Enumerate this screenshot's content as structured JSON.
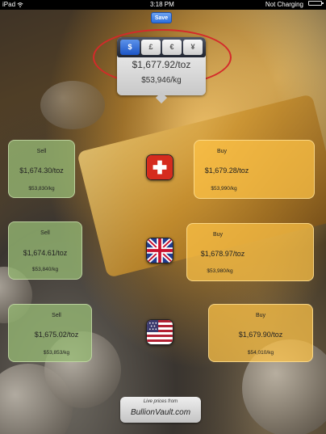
{
  "status_bar": {
    "device": "iPad",
    "time": "3:18 PM",
    "charging": "Not Charging"
  },
  "toolbar": {
    "save_label": "Save"
  },
  "currency_selector": {
    "options": [
      "$",
      "£",
      "€",
      "¥"
    ],
    "selected": "$",
    "price_per_toz": "$1,677.92/toz",
    "price_per_kg": "$53,946/kg"
  },
  "markets": [
    {
      "flag_icon": "switzerland-flag-icon",
      "sell": {
        "label": "Sell",
        "price_per_toz": "$1,674.30/toz",
        "price_per_kg": "$53,830/kg"
      },
      "buy": {
        "label": "Buy",
        "price_per_toz": "$1,679.28/toz",
        "price_per_kg": "$53,990/kg"
      }
    },
    {
      "flag_icon": "uk-flag-icon",
      "sell": {
        "label": "Sell",
        "price_per_toz": "$1,674.61/toz",
        "price_per_kg": "$53,840/kg"
      },
      "buy": {
        "label": "Buy",
        "price_per_toz": "$1,678.97/toz",
        "price_per_kg": "$53,980/kg"
      }
    },
    {
      "flag_icon": "us-flag-icon",
      "sell": {
        "label": "Sell",
        "price_per_toz": "$1,675.02/toz",
        "price_per_kg": "$53,853/kg"
      },
      "buy": {
        "label": "Buy",
        "price_per_toz": "$1,679.90/toz",
        "price_per_kg": "$54,010/kg"
      }
    }
  ],
  "footer": {
    "live_text": "Live prices from",
    "brand": "BullionVault.com"
  },
  "colors": {
    "highlight_ring": "#d42a2a",
    "save_button": "#2d6fdc",
    "sell_card": "#96b973",
    "buy_card": "#ffc446"
  }
}
